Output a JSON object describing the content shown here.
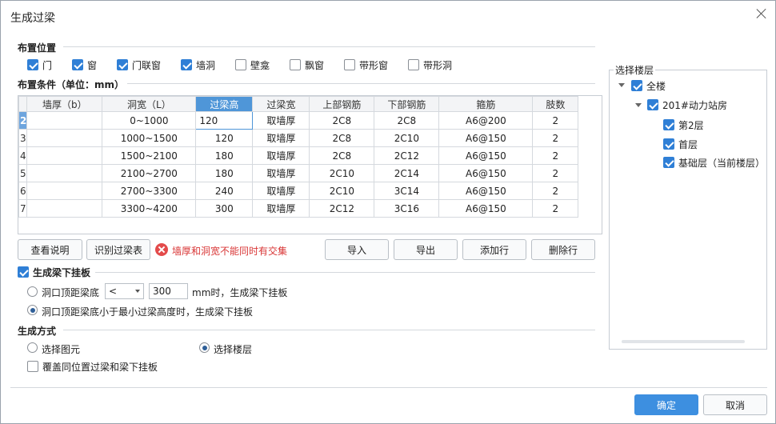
{
  "dialog": {
    "title": "生成过梁"
  },
  "placement": {
    "title": "布置位置",
    "options": [
      {
        "label": "门",
        "checked": true
      },
      {
        "label": "窗",
        "checked": true
      },
      {
        "label": "门联窗",
        "checked": true
      },
      {
        "label": "墙洞",
        "checked": true
      },
      {
        "label": "壁龛",
        "checked": false
      },
      {
        "label": "飘窗",
        "checked": false
      },
      {
        "label": "带形窗",
        "checked": false
      },
      {
        "label": "带形洞",
        "checked": false
      }
    ]
  },
  "conditions": {
    "title": "布置条件（单位：mm）",
    "headers": [
      "墙厚（b）",
      "洞宽（L）",
      "过梁高",
      "过梁宽",
      "上部钢筋",
      "下部钢筋",
      "箍筋",
      "肢数"
    ],
    "rows": [
      {
        "num": "2",
        "wall": "",
        "width": "0~1000",
        "height": "120",
        "beam_w": "取墙厚",
        "top": "2C8",
        "bottom": "2C8",
        "stirrup": "A6@200",
        "legs": "2"
      },
      {
        "num": "3",
        "wall": "",
        "width": "1000~1500",
        "height": "120",
        "beam_w": "取墙厚",
        "top": "2C8",
        "bottom": "2C10",
        "stirrup": "A6@150",
        "legs": "2"
      },
      {
        "num": "4",
        "wall": "",
        "width": "1500~2100",
        "height": "180",
        "beam_w": "取墙厚",
        "top": "2C8",
        "bottom": "2C12",
        "stirrup": "A6@150",
        "legs": "2"
      },
      {
        "num": "5",
        "wall": "",
        "width": "2100~2700",
        "height": "180",
        "beam_w": "取墙厚",
        "top": "2C10",
        "bottom": "2C14",
        "stirrup": "A6@150",
        "legs": "2"
      },
      {
        "num": "6",
        "wall": "",
        "width": "2700~3300",
        "height": "240",
        "beam_w": "取墙厚",
        "top": "2C10",
        "bottom": "3C14",
        "stirrup": "A6@150",
        "legs": "2"
      },
      {
        "num": "7",
        "wall": "",
        "width": "3300~4200",
        "height": "300",
        "beam_w": "取墙厚",
        "top": "2C12",
        "bottom": "3C16",
        "stirrup": "A6@150",
        "legs": "2"
      }
    ]
  },
  "buttons": {
    "view_help": "查看说明",
    "identify": "识别过梁表",
    "import": "导入",
    "export": "导出",
    "add_row": "添加行",
    "delete_row": "删除行",
    "ok": "确定",
    "cancel": "取消"
  },
  "error": {
    "text": "墙厚和洞宽不能同时有交集"
  },
  "hanging": {
    "title": "生成梁下挂板",
    "checked": true,
    "option1_prefix": "洞口顶距梁底",
    "operator": "<",
    "distance": "300",
    "option1_suffix": "mm时，生成梁下挂板",
    "option2": "洞口顶距梁底小于最小过梁高度时，生成梁下挂板",
    "selected": 2
  },
  "method": {
    "title": "生成方式",
    "opt_elements": "选择图元",
    "opt_floors": "选择楼层",
    "selected": "floors",
    "overwrite": "覆盖同位置过梁和梁下挂板",
    "overwrite_checked": false
  },
  "floors": {
    "title": "选择楼层",
    "all": "全楼",
    "building": "201#动力站房",
    "items": [
      "第2层",
      "首层",
      "基础层（当前楼层）"
    ]
  },
  "colors": {
    "accent": "#3d8fe0",
    "header_active": "#4f96d8",
    "error": "#d93636"
  }
}
